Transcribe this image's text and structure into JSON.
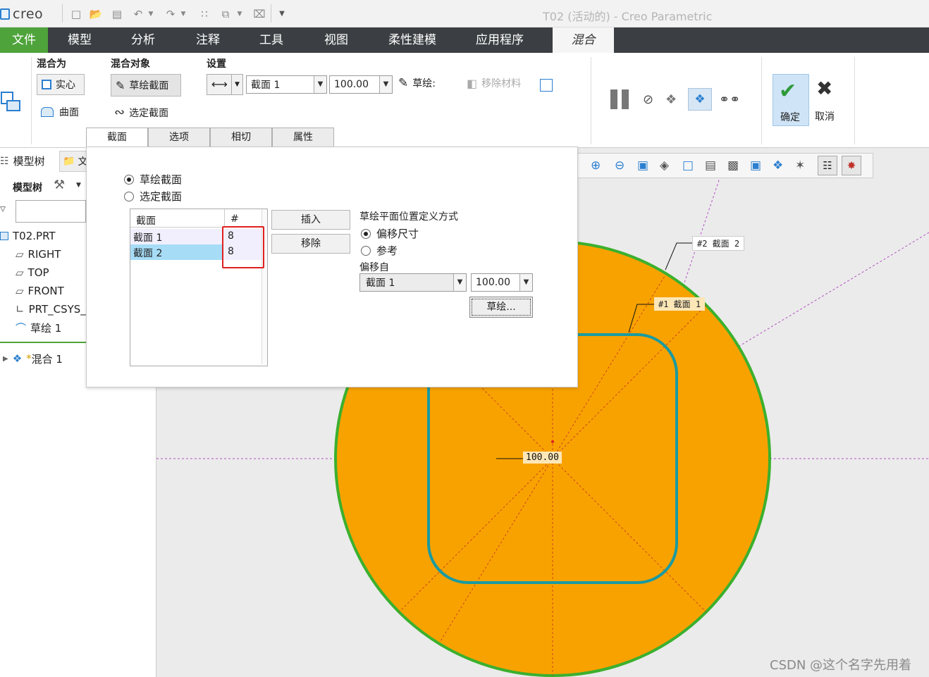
{
  "app": {
    "logo": "creo",
    "window_title": "T02 (活动的) - Creo Parametric"
  },
  "quick_access": [
    "new-icon",
    "open-icon",
    "save-icon",
    "undo-icon",
    "redo-icon",
    "regenerate-icon",
    "windows-icon",
    "close-icon",
    "customize-icon"
  ],
  "tabs": [
    "文件",
    "模型",
    "分析",
    "注释",
    "工具",
    "视图",
    "柔性建模",
    "应用程序",
    "混合"
  ],
  "ribbon": {
    "blend_as": {
      "title": "混合为",
      "solid": "实心",
      "surface": "曲面"
    },
    "blend_object": {
      "title": "混合对象",
      "sketch_sections": "草绘截面",
      "selected_sections": "选定截面"
    },
    "settings": {
      "title": "设置",
      "section_value": "截面 1",
      "offset_value": "100.00",
      "sketch_label": "草绘:",
      "remove_material": "移除材料"
    },
    "ok": "确定",
    "cancel": "取消"
  },
  "subtabs": [
    "截面",
    "选项",
    "相切",
    "属性"
  ],
  "tree": {
    "tab_model_tree": "模型树",
    "tab_folder": "文",
    "header": "模型树",
    "items": [
      {
        "label": "T02.PRT",
        "icon": "part-icon"
      },
      {
        "label": "RIGHT",
        "icon": "datum-plane-icon"
      },
      {
        "label": "TOP",
        "icon": "datum-plane-icon"
      },
      {
        "label": "FRONT",
        "icon": "datum-plane-icon"
      },
      {
        "label": "PRT_CSYS_",
        "icon": "csys-icon"
      },
      {
        "label": "草绘 1",
        "icon": "sketch-icon"
      },
      {
        "label": "混合 1",
        "icon": "blend-feature-icon"
      }
    ],
    "new_marker": "*"
  },
  "dialog": {
    "radio_sketch": "草绘截面",
    "radio_select": "选定截面",
    "table": {
      "headers": [
        "截面",
        "#"
      ],
      "rows": [
        {
          "name": "截面 1",
          "count": "8"
        },
        {
          "name": "截面 2",
          "count": "8"
        }
      ]
    },
    "insert": "插入",
    "remove": "移除",
    "plane_def_title": "草绘平面位置定义方式",
    "offset_dim": "偏移尺寸",
    "reference": "参考",
    "offset_from": "偏移自",
    "offset_from_value": "截面 1",
    "offset_value": "100.00",
    "sketch_button": "草绘..."
  },
  "canvas": {
    "label_section2": "#2 截面 2",
    "label_section1": "#1 截面 1",
    "dimension": "100.00"
  },
  "colors": {
    "accent_green": "#4ea33a",
    "tab_bar": "#3b3f43",
    "disc": "#f8a200",
    "profile": "#1a9aa0",
    "highlight_red": "#e02020"
  },
  "watermark": "CSDN @这个名字先用着"
}
